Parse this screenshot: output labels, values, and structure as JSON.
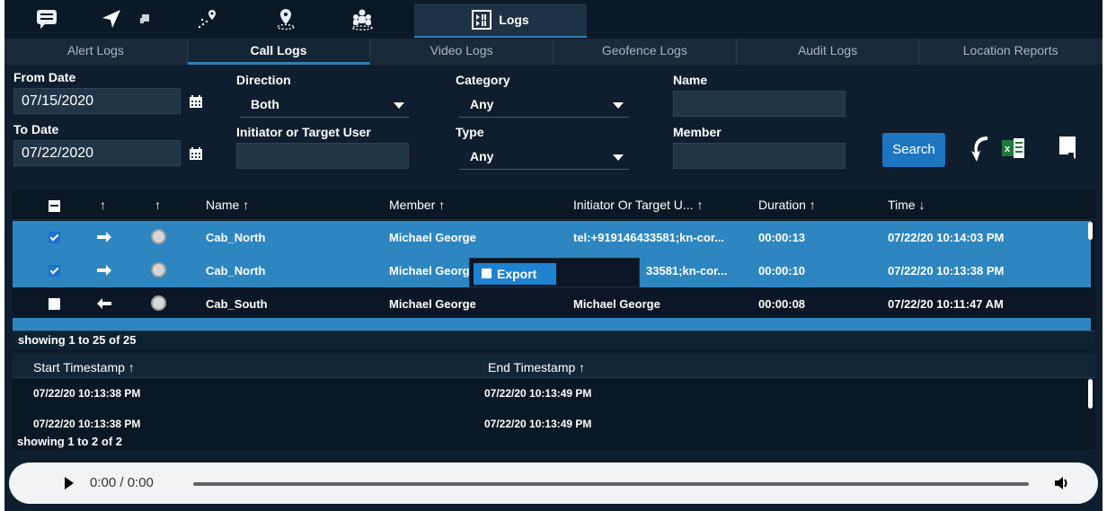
{
  "topbar": {
    "icons": [
      "chat-icon",
      "navigation-arrow-icon",
      "map-route-icon",
      "location-pin-icon",
      "group-icon"
    ],
    "active_tab_label": "Logs"
  },
  "subtabs": [
    {
      "label": "Alert Logs",
      "active": false
    },
    {
      "label": "Call Logs",
      "active": true
    },
    {
      "label": "Video Logs",
      "active": false
    },
    {
      "label": "Geofence Logs",
      "active": false
    },
    {
      "label": "Audit Logs",
      "active": false
    },
    {
      "label": "Location Reports",
      "active": false
    }
  ],
  "filters": {
    "from_date_label": "From Date",
    "from_date_value": "07/15/2020",
    "to_date_label": "To Date",
    "to_date_value": "07/22/2020",
    "direction_label": "Direction",
    "direction_value": "Both",
    "initiator_label": "Initiator or Target User",
    "initiator_value": "",
    "category_label": "Category",
    "category_value": "Any",
    "type_label": "Type",
    "type_value": "Any",
    "name_label": "Name",
    "name_value": "",
    "member_label": "Member",
    "member_value": "",
    "search_label": "Search"
  },
  "grid": {
    "headers": {
      "dir": "↑",
      "type": "↑",
      "name": "Name ↑",
      "member": "Member ↑",
      "initiator": "Initiator Or Target U... ↑",
      "duration": "Duration ↑",
      "time": "Time ↓"
    },
    "rows": [
      {
        "checked": true,
        "direction": "outgoing",
        "name": "Cab_North",
        "member": "Michael George",
        "initiator": "tel:+919146433581;kn-cor...",
        "duration": "00:00:13",
        "time": "07/22/20 10:14:03 PM"
      },
      {
        "checked": true,
        "direction": "outgoing",
        "name": "Cab_North",
        "member": "Michael Georg",
        "initiator": "33581;kn-cor...",
        "duration": "00:00:10",
        "time": "07/22/20 10:13:38 PM"
      },
      {
        "checked": false,
        "direction": "incoming",
        "name": "Cab_South",
        "member": "Michael George",
        "initiator": "Michael George",
        "duration": "00:00:08",
        "time": "07/22/20 10:11:47 AM"
      }
    ],
    "footer": "showing 1 to 25 of 25"
  },
  "context_menu": {
    "export_label": "Export"
  },
  "subgrid": {
    "headers": {
      "start": "Start Timestamp ↑",
      "end": "End Timestamp ↑"
    },
    "rows": [
      {
        "start": "07/22/20 10:13:38 PM",
        "end": "07/22/20 10:13:49 PM"
      },
      {
        "start": "07/22/20 10:13:38 PM",
        "end": "07/22/20 10:13:49 PM"
      }
    ],
    "footer": "showing 1 to 2 of 2"
  },
  "player": {
    "time": "0:00 / 0:00"
  },
  "colors": {
    "accent": "#2f7fb3",
    "selected_row": "#2e86c1",
    "background": "#0e1e2e"
  }
}
